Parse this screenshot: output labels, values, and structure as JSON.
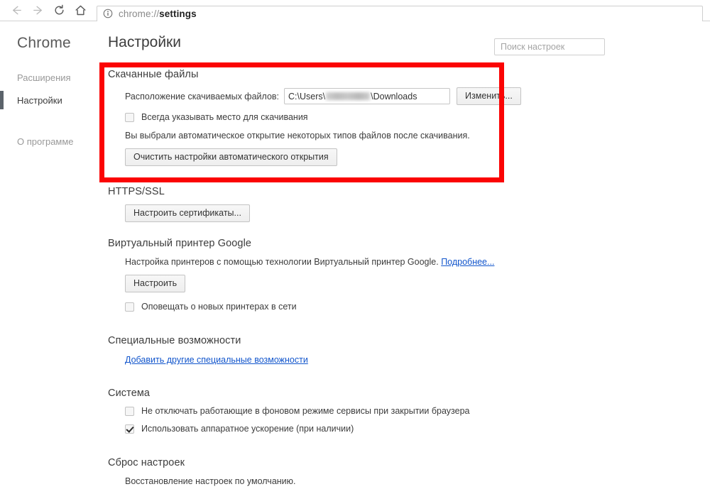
{
  "browser": {
    "nav": {
      "back_label": "Назад",
      "forward_label": "Вперёд",
      "reload_label": "Обновить",
      "home_label": "Главная страница"
    },
    "omnibox": {
      "url_prefix": "chrome://",
      "url_suffix": "settings",
      "full_url": "chrome://settings",
      "info_icon": "info-circle-icon"
    }
  },
  "sidebar": {
    "title": "Chrome",
    "items": [
      {
        "label": "Расширения",
        "active": false
      },
      {
        "label": "Настройки",
        "active": true
      },
      {
        "label": "О программе",
        "active": false
      }
    ]
  },
  "header": {
    "title": "Настройки"
  },
  "search": {
    "placeholder": "Поиск настроек",
    "value": "",
    "icon": "search-icon"
  },
  "highlight": {
    "color": "#fb0404",
    "target_section": "Скачанные файлы"
  },
  "sections": {
    "downloads": {
      "title": "Скачанные файлы",
      "path_label": "Расположение скачиваемых файлов:",
      "path_prefix": "C:\\Users\\",
      "path_redacted": true,
      "path_suffix": "\\Downloads",
      "change_button": "Изменить...",
      "always_ask_checkbox": {
        "label": "Всегда указывать место для скачивания",
        "checked": false
      },
      "auto_open_text": "Вы выбрали автоматическое открытие некоторых типов файлов после скачивания.",
      "clear_auto_open_button": "Очистить настройки автоматического открытия"
    },
    "https_ssl": {
      "title": "HTTPS/SSL",
      "manage_certs_button": "Настроить сертификаты..."
    },
    "cloud_print": {
      "title": "Виртуальный принтер Google",
      "description": "Настройка принтеров с помощью технологии Виртуальный принтер Google.",
      "learn_more_link": "Подробнее...",
      "setup_button": "Настроить",
      "notify_checkbox": {
        "label": "Оповещать о новых принтерах в сети",
        "checked": false
      }
    },
    "accessibility": {
      "title": "Специальные возможности",
      "add_features_link": "Добавить другие специальные возможности"
    },
    "system": {
      "title": "Система",
      "background_apps_checkbox": {
        "label": "Не отключать работающие в фоновом режиме сервисы при закрытии браузера",
        "checked": false
      },
      "hardware_accel_checkbox": {
        "label": "Использовать аппаратное ускорение (при наличии)",
        "checked": true
      }
    },
    "reset": {
      "title": "Сброс настроек",
      "description": "Восстановление настроек по умолчанию."
    }
  }
}
